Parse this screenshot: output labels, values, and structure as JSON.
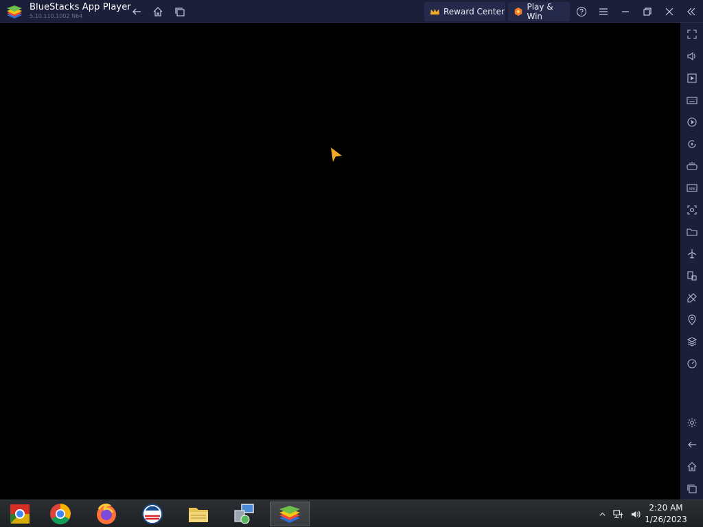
{
  "titlebar": {
    "title": "BlueStacks App Player",
    "version": "5.10.110.1002 N64",
    "reward_label": "Reward Center",
    "playwin_label": "Play & Win"
  },
  "taskbar": {
    "time": "2:20 AM",
    "date": "1/26/2023"
  },
  "colors": {
    "titlebar_bg": "#1c1f3a",
    "accent_gold": "#f0a82a",
    "screen_bg": "#000000"
  }
}
